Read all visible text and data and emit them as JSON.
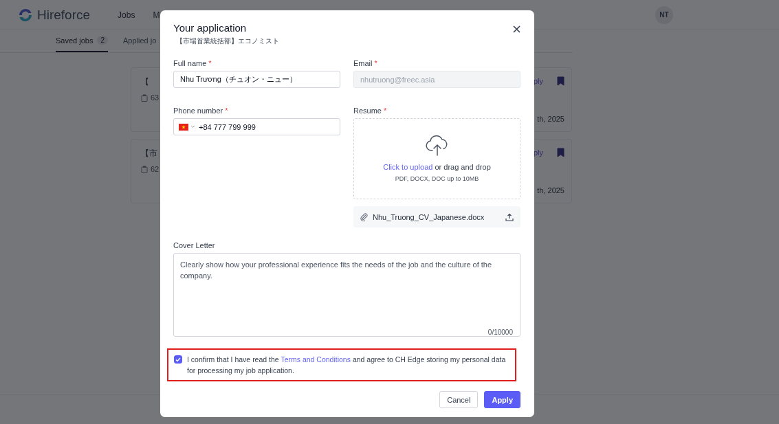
{
  "header": {
    "logo": "Hireforce",
    "nav": [
      {
        "label": "Jobs"
      },
      {
        "label": "M"
      }
    ],
    "avatar": "NT"
  },
  "tabs": [
    {
      "label": "Saved jobs",
      "count": "2",
      "selected": true
    },
    {
      "label": "Applied jo",
      "selected": false
    }
  ],
  "cards": [
    {
      "title": "【",
      "count": "63",
      "action": "ply",
      "date": "th, 2025",
      "saved": true
    },
    {
      "title": "【市",
      "count": "62",
      "action": "ply",
      "date": "th, 2025",
      "saved": true
    }
  ],
  "modal": {
    "title": "Your application",
    "subtitle": "【市場首業統括部】エコノミスト",
    "full_name": {
      "label": "Full name",
      "required_mark": "*",
      "value": "Nhu Trương（チュオン・ニュー）"
    },
    "email": {
      "label": "Email",
      "required_mark": "*",
      "value": "nhutruong@freec.asia",
      "disabled": true
    },
    "phone": {
      "label": "Phone number",
      "required_mark": "*",
      "value": "+84 777 799 999"
    },
    "resume": {
      "label": "Resume",
      "required_mark": "*",
      "upload_link": "Click to upload",
      "upload_text": "or drag and drop",
      "hint": "PDF, DOCX, DOC up to 10MB",
      "file": "Nhu_Truong_CV_Japanese.docx"
    },
    "cover_letter": {
      "label": "Cover Letter",
      "placeholder": "Clearly show how your professional experience fits the needs of the job and the culture of the company.",
      "counter": "0/10000"
    },
    "consent": {
      "checked": true,
      "highlighted": true,
      "before": "I confirm that I have read the",
      "link": "Terms and Conditions",
      "after": "and agree to CH Edge storing my personal data for processing my job application."
    },
    "buttons": [
      {
        "label": "Cancel",
        "kind": "secondary"
      },
      {
        "label": "Apply",
        "kind": "primary"
      }
    ]
  }
}
